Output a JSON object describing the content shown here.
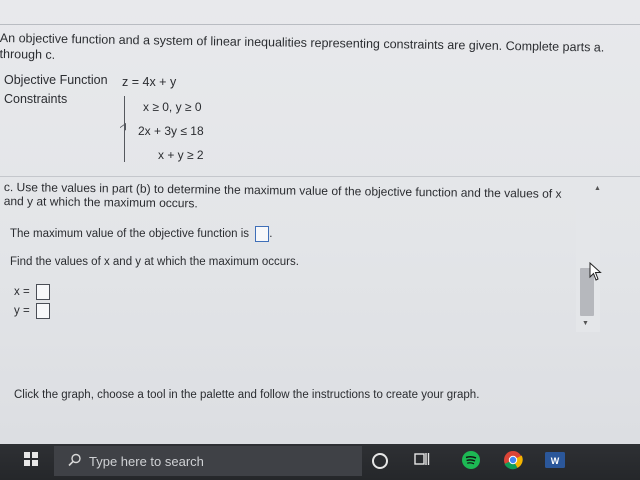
{
  "problem": {
    "intro": "An objective function and a system of linear inequalities representing constraints are given. Complete parts a. through c.",
    "objective_label": "Objective Function",
    "objective_expr": "z = 4x + y",
    "constraints_label": "Constraints",
    "constraints": [
      "x ≥ 0, y ≥ 0",
      "2x + 3y ≤ 18",
      "x + y ≥ 2"
    ]
  },
  "part_c": {
    "prompt": "c. Use the values in part (b) to determine the maximum value of the objective function and the values of x and y at which the maximum occurs.",
    "max_label": "The maximum value of the objective function is",
    "max_suffix": ".",
    "find_label": "Find the values of x and y at which the maximum occurs.",
    "x_label": "x =",
    "y_label": "y =",
    "max_value": "",
    "x_value": "",
    "y_value": ""
  },
  "graph_instructions": "Click the graph, choose a tool in the palette and follow the instructions to create your graph.",
  "taskbar": {
    "search_placeholder": "Type here to search",
    "apps": [
      "cortana-icon",
      "task-view-icon",
      "spotify-icon",
      "chrome-icon",
      "word-icon"
    ]
  },
  "colors": {
    "taskbar": "#25272a",
    "spotify": "#1db954",
    "word": "#2b579a",
    "answer_box_highlight": "#3f6fb8"
  }
}
